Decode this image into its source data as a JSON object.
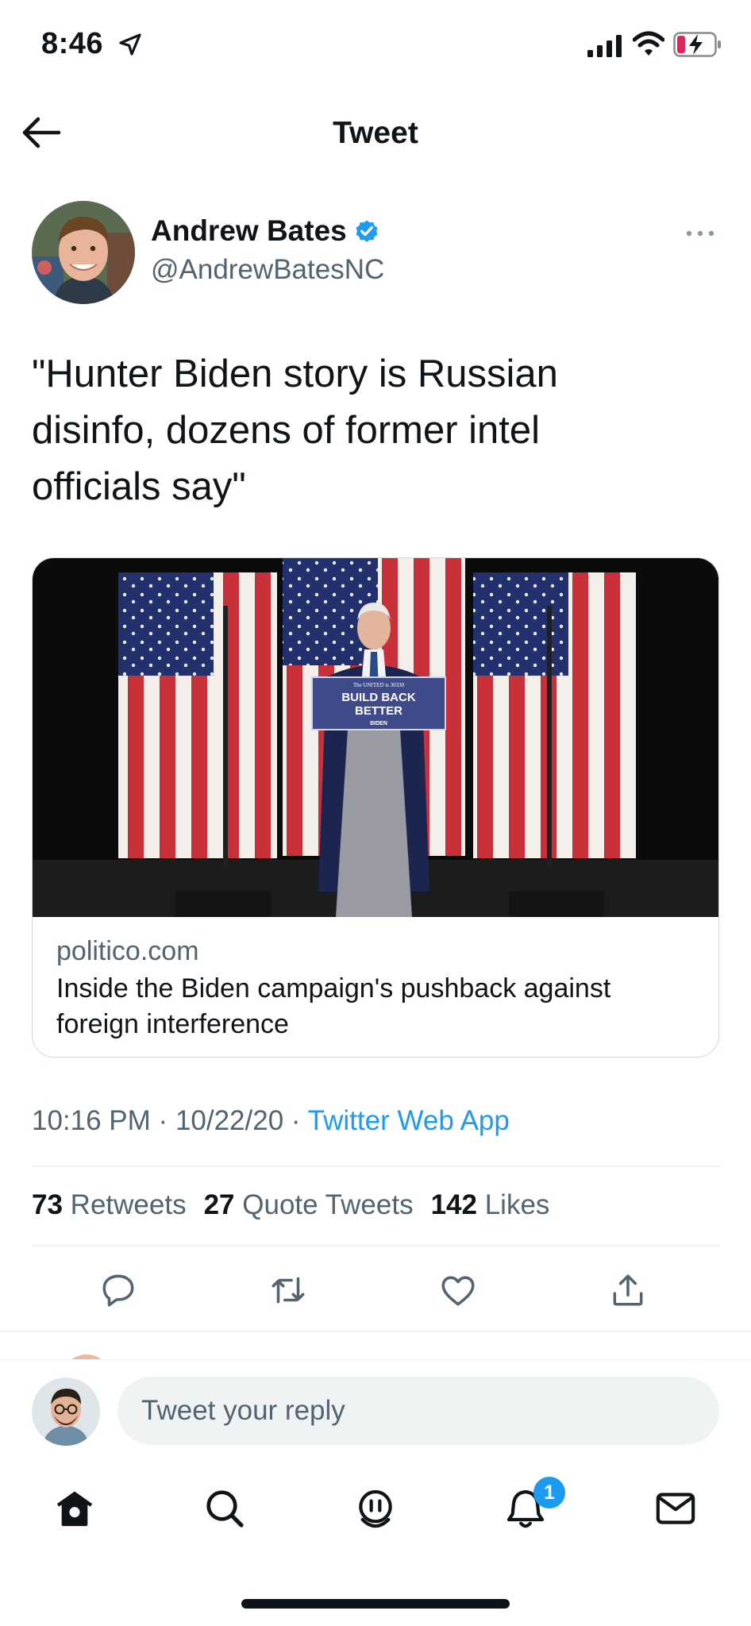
{
  "status_bar": {
    "time": "8:46"
  },
  "header": {
    "title": "Tweet"
  },
  "tweet": {
    "author_name": "Andrew Bates",
    "author_handle": "@AndrewBatesNC",
    "text": "\"Hunter Biden story is Russian\ndisinfo, dozens of former intel\nofficials say\"",
    "card": {
      "image_podium_line1": "The UNITED is 30330",
      "image_podium_line2": "BUILD BACK",
      "image_podium_line3": "BETTER",
      "image_podium_line4": "BIDEN",
      "domain": "politico.com",
      "title": "Inside the Biden campaign's pushback against foreign interference"
    },
    "meta": {
      "time": "10:16 PM",
      "date": "10/22/20",
      "separator": "·",
      "source": "Twitter Web App"
    },
    "stats": {
      "retweets_count": "73",
      "retweets_label": "Retweets",
      "quotes_count": "27",
      "quotes_label": "Quote Tweets",
      "likes_count": "142",
      "likes_label": "Likes"
    },
    "actions": [
      "reply-icon",
      "retweet-icon",
      "like-icon",
      "share-icon"
    ]
  },
  "reply_bar": {
    "placeholder": "Tweet your reply"
  },
  "tab_bar": {
    "items": [
      "home-icon",
      "search-icon",
      "spaces-icon",
      "notifications-icon",
      "messages-icon"
    ],
    "notifications_badge": "1"
  },
  "colors": {
    "accent": "#1d9bf0",
    "secondary_text": "#536471",
    "divider": "#eff3f4"
  }
}
